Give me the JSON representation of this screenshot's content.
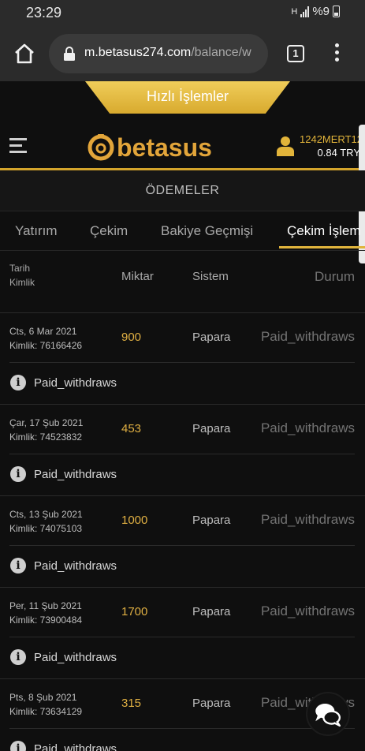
{
  "status_bar": {
    "time": "23:29",
    "network": "H",
    "battery": "%9"
  },
  "browser": {
    "url_host": "m.betasus274.com",
    "url_path": "/balance/w",
    "tab_count": "1"
  },
  "quick_actions": {
    "label": "Hızlı İşlemler"
  },
  "header": {
    "logo_text": "betasus",
    "username": "1242MERT12",
    "balance": "0.84 TRY"
  },
  "page": {
    "title": "ÖDEMELER"
  },
  "tabs": [
    {
      "label": "Yatırım"
    },
    {
      "label": "Çekim"
    },
    {
      "label": "Bakiye Geçmişi"
    },
    {
      "label": "Çekim İşlem"
    }
  ],
  "table": {
    "headers": {
      "date": "Tarih",
      "id": "Kimlik",
      "amount": "Miktar",
      "system": "Sistem",
      "status": "Durum"
    },
    "rows": [
      {
        "date": "Cts, 6 Mar 2021",
        "id": "Kimlik: 76166426",
        "amount": "900",
        "system": "Papara",
        "status": "Paid_withdraws",
        "note": "Paid_withdraws"
      },
      {
        "date": "Çar, 17 Şub 2021",
        "id": "Kimlik: 74523832",
        "amount": "453",
        "system": "Papara",
        "status": "Paid_withdraws",
        "note": "Paid_withdraws"
      },
      {
        "date": "Cts, 13 Şub 2021",
        "id": "Kimlik: 74075103",
        "amount": "1000",
        "system": "Papara",
        "status": "Paid_withdraws",
        "note": "Paid_withdraws"
      },
      {
        "date": "Per, 11 Şub 2021",
        "id": "Kimlik: 73900484",
        "amount": "1700",
        "system": "Papara",
        "status": "Paid_withdraws",
        "note": "Paid_withdraws"
      },
      {
        "date": "Pts, 8 Şub 2021",
        "id": "Kimlik: 73634129",
        "amount": "315",
        "system": "Papara",
        "status": "Paid_withdraws",
        "note": "Paid_withdraws"
      }
    ]
  },
  "icons": {
    "home": "home-icon",
    "lock": "lock-icon",
    "menu": "more-vert-icon",
    "burger": "hamburger-icon",
    "user": "user-icon",
    "info": "info-icon",
    "chat": "chat-icon"
  },
  "colors": {
    "accent": "#d4a52c",
    "background": "#0f0f0f",
    "amount": "#e0b043",
    "status": "#737373"
  }
}
